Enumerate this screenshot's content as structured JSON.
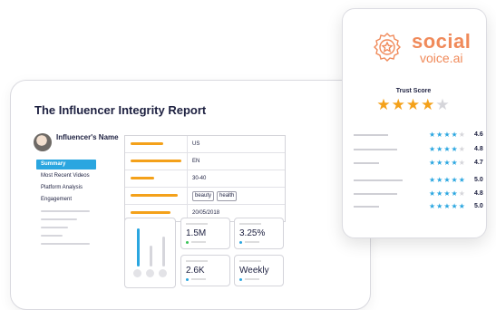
{
  "report": {
    "title": "The Influencer Integrity Report",
    "influencer_label": "Influencer's Name",
    "nav": [
      "Summary",
      "Most Recent Videos",
      "Platform Analysis",
      "Engagement"
    ],
    "details": {
      "country": "US",
      "language": "EN",
      "age_range": "30-40",
      "tags": [
        "beauty",
        "health"
      ],
      "date": "20/05/2018"
    },
    "stats": [
      {
        "value": "1.5M",
        "indicator_color": "#3cc45a"
      },
      {
        "value": "3.25%",
        "indicator_color": "#2aa6e0"
      },
      {
        "value": "2.6K",
        "indicator_color": "#2aa6e0"
      },
      {
        "value": "Weekly",
        "indicator_color": "#2aa6e0"
      }
    ]
  },
  "trust": {
    "brand_top": "social",
    "brand_bottom": "voice.ai",
    "title": "Trust Score",
    "overall_stars": 4,
    "ratings": [
      {
        "score": "4.6",
        "stars": 4
      },
      {
        "score": "4.8",
        "stars": 4
      },
      {
        "score": "4.7",
        "stars": 4
      },
      {
        "score": "5.0",
        "stars": 5
      },
      {
        "score": "4.8",
        "stars": 4
      },
      {
        "score": "5.0",
        "stars": 5
      }
    ]
  },
  "colors": {
    "accent_blue": "#2aa6e0",
    "accent_orange": "#f4a11a",
    "brand_coral": "#f08a5a"
  },
  "icons": [
    "avatar",
    "award-badge-icon",
    "star-icon"
  ]
}
